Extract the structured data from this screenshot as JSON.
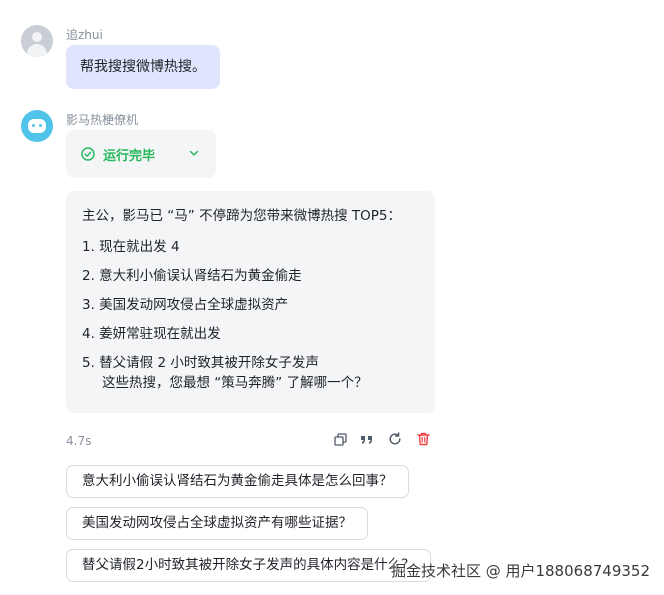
{
  "user": {
    "name": "追zhui",
    "message": "帮我搜搜微博热搜。"
  },
  "bot": {
    "name": "影马热梗僚机",
    "status": "运行完毕",
    "intro": "主公，影马已 “马” 不停蹄为您带来微博热搜 TOP5：",
    "items": [
      "1. 现在就出发 4",
      "2. 意大利小偷误认肾结石为黄金偷走",
      "3. 美国发动网攻侵占全球虚拟资产",
      "4. 姜妍常驻现在就出发",
      "5. 替父请假 2 小时致其被开除女子发声"
    ],
    "closing": "这些热搜，您最想 “策马奔腾” 了解哪一个？",
    "elapsed": "4.7s"
  },
  "suggestions": [
    "意大利小偷误认肾结石为黄金偷走具体是怎么回事？",
    "美国发动网攻侵占全球虚拟资产有哪些证据？",
    "替父请假2小时致其被开除女子发声的具体内容是什么？"
  ],
  "watermark": "掘金技术社区 @ 用户188068749352",
  "icons": {
    "user_avatar": "user-avatar-icon",
    "bot_avatar": "bot-avatar-icon",
    "status": "check-circle-icon",
    "expand": "chevron-down-icon",
    "copy": "copy-icon",
    "quote": "quote-icon",
    "regenerate": "refresh-icon",
    "delete": "trash-icon"
  },
  "colors": {
    "user_bubble": "#e0e4fd",
    "bot_bubble": "#f4f5f7",
    "status_green": "#23b85a",
    "delete_red": "#f53f3f",
    "bot_avatar": "#4fc3e8"
  }
}
